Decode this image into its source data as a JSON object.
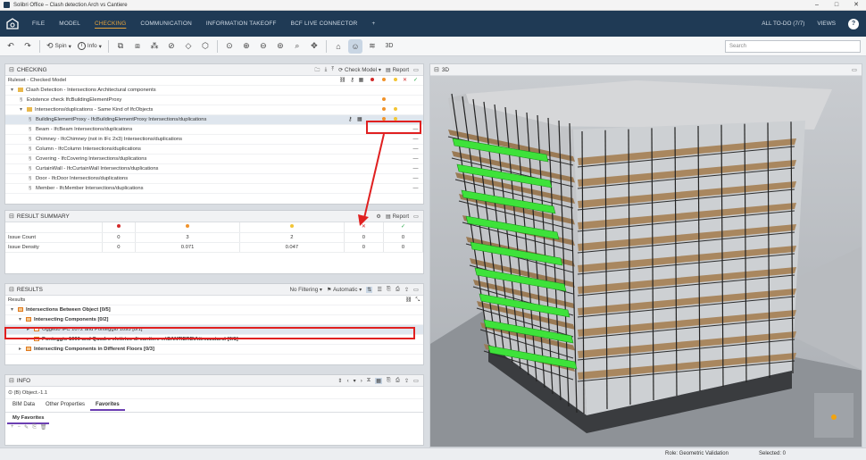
{
  "window": {
    "title": "Solibri Office – Clash detection Arch vs Cantiere",
    "min": "–",
    "max": "□",
    "close": "✕"
  },
  "menu": {
    "items": [
      "FILE",
      "MODEL",
      "CHECKING",
      "COMMUNICATION",
      "INFORMATION TAKEOFF",
      "BCF LIVE CONNECTOR",
      "+"
    ],
    "active_index": 2,
    "right": {
      "todo": "ALL TO-DO (7/7)",
      "views": "VIEWS",
      "help": "?"
    }
  },
  "toolbar": {
    "spin_label": "Spin",
    "info_label": "Info",
    "search_placeholder": "Search"
  },
  "checking": {
    "title": "CHECKING",
    "check_model_label": "Check Model",
    "report_label": "Report",
    "ruleset_label": "Ruleset - Checked Model",
    "rows": [
      {
        "indent": 0,
        "caret": "▾",
        "text": "Clash Detection - Intersections Architectural components",
        "marks": []
      },
      {
        "indent": 1,
        "caret": "",
        "text": "Existence check IfcBuildingElementProxy",
        "marks": [
          "orange"
        ]
      },
      {
        "indent": 1,
        "caret": "▾",
        "text": "Intersections/duplications - Same Kind of IfcObjects",
        "marks": [
          "orange",
          "yellow"
        ]
      },
      {
        "indent": 2,
        "caret": "",
        "text": "BuildingElementProxy - IfcBuildingElementProxy Intersections/duplications",
        "marks": [
          "orange",
          "yellow"
        ],
        "selected": true
      },
      {
        "indent": 2,
        "caret": "",
        "text": "Beam - IfcBeam Intersections/duplications",
        "marks": [
          "dash"
        ]
      },
      {
        "indent": 2,
        "caret": "",
        "text": "Chimney - IfcChimney (not in IFc 2x3) Intersections/duplications",
        "marks": [
          "dash"
        ]
      },
      {
        "indent": 2,
        "caret": "",
        "text": "Column - IfcColumn Intersections/duplications",
        "marks": [
          "dash"
        ]
      },
      {
        "indent": 2,
        "caret": "",
        "text": "Covering - IfcCovering Intersections/duplications",
        "marks": [
          "dash"
        ]
      },
      {
        "indent": 2,
        "caret": "",
        "text": "CurtainWall - IfcCurtainWall Intersections/duplications",
        "marks": [
          "dash"
        ]
      },
      {
        "indent": 2,
        "caret": "",
        "text": "Door - IfcDoor Intersections/duplications",
        "marks": [
          "dash"
        ]
      },
      {
        "indent": 2,
        "caret": "",
        "text": "Member - IfcMember Intersections/duplications",
        "marks": [
          "dash"
        ]
      }
    ]
  },
  "result_summary": {
    "title": "RESULT SUMMARY",
    "report_label": "Report",
    "rows": [
      {
        "label": "Issue Count",
        "values": [
          "0",
          "3",
          "2",
          "0",
          "0"
        ]
      },
      {
        "label": "Issue Density",
        "values": [
          "0",
          "0.071",
          "0.047",
          "0",
          "0"
        ]
      }
    ]
  },
  "results": {
    "title": "RESULTS",
    "filter_label": "No Filtering",
    "automatic_label": "Automatic",
    "header": "Results",
    "rows": [
      {
        "indent": 0,
        "caret": "▾",
        "text": "Intersections Between Object [0/5]",
        "bold": true
      },
      {
        "indent": 1,
        "caret": "▾",
        "text": "Intersecting Components [0/2]",
        "bold": true
      },
      {
        "indent": 2,
        "caret": "▸",
        "text": "Oggetto IFC 1072 and Ponteggio 1095 [0/1]",
        "bold": false,
        "selected": true
      },
      {
        "indent": 2,
        "caret": "▸",
        "text": "Ponteggio 1090 and Quadro elettrico di cantiere ...\\CANTIERE\\Attrezzatura\\ [0/1]",
        "bold": true
      },
      {
        "indent": 1,
        "caret": "▸",
        "text": "Intersecting Components in Different Floors [0/3]",
        "bold": true
      }
    ]
  },
  "info": {
    "title": "INFO",
    "object": "(B) Object.-1.1",
    "tabs": [
      "BIM Data",
      "Other Properties",
      "Favorites"
    ],
    "active_tab": 2,
    "subtab": "My Favorites"
  },
  "view3d": {
    "title": "3D"
  },
  "status": {
    "role": "Role: Geometric Validation",
    "selected": "Selected: 0"
  },
  "colors": {
    "menubar": "#1f3a55",
    "accent": "#e8a43a",
    "highlight": "#e02020",
    "clash_green": "#3ee23a",
    "red": "#d32a2a",
    "orange": "#f0932b",
    "yellow": "#f2c535"
  }
}
